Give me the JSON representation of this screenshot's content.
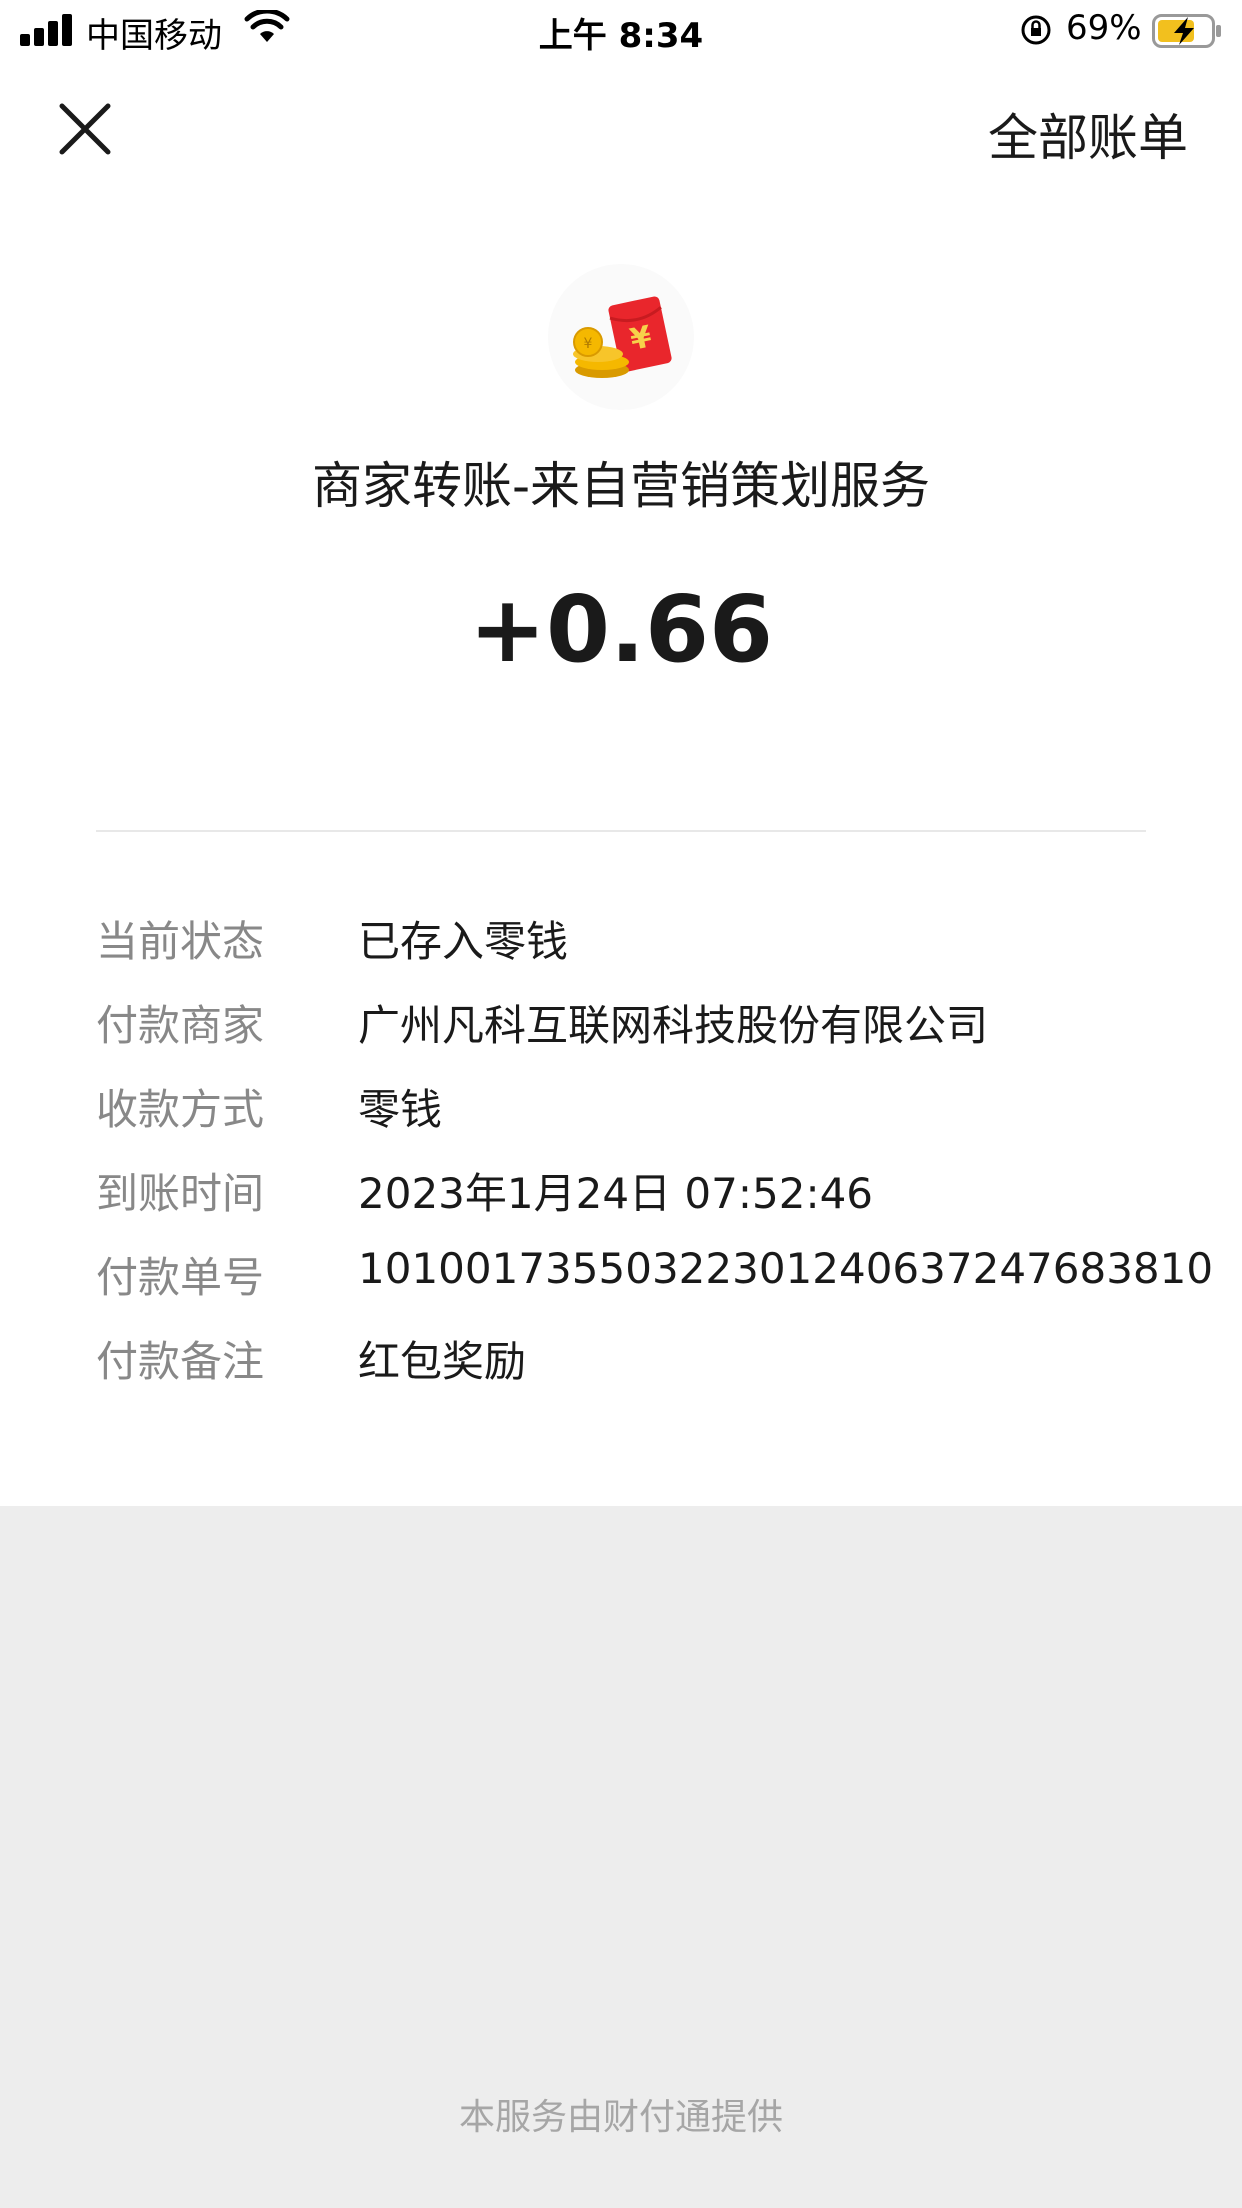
{
  "status_bar": {
    "carrier": "中国移动",
    "time": "上午 8:34",
    "battery_percent": "69%"
  },
  "nav": {
    "close_icon": "close-icon",
    "all_bills_label": "全部账单"
  },
  "header": {
    "logo_icon": "red-packet-coins-icon",
    "title": "商家转账-来自营销策划服务",
    "amount": "+0.66"
  },
  "details": [
    {
      "key": "当前状态",
      "value": "已存入零钱"
    },
    {
      "key": "付款商家",
      "value": "广州凡科互联网科技股份有限公司"
    },
    {
      "key": "收款方式",
      "value": "零钱"
    },
    {
      "key": "到账时间",
      "value": "2023年1月24日 07:52:46"
    },
    {
      "key": "付款单号",
      "value": "101001735503223012406372476838​10"
    },
    {
      "key": "付款备注",
      "value": "红包奖励"
    }
  ],
  "footer": {
    "text": "本服务由财付通提供"
  },
  "colors": {
    "page_bg": "#ffffff",
    "lower_bg": "#ededed",
    "key_text": "#888888",
    "value_text": "#1a1a1a",
    "red_packet": "#e9262c",
    "coin": "#f5b800"
  }
}
